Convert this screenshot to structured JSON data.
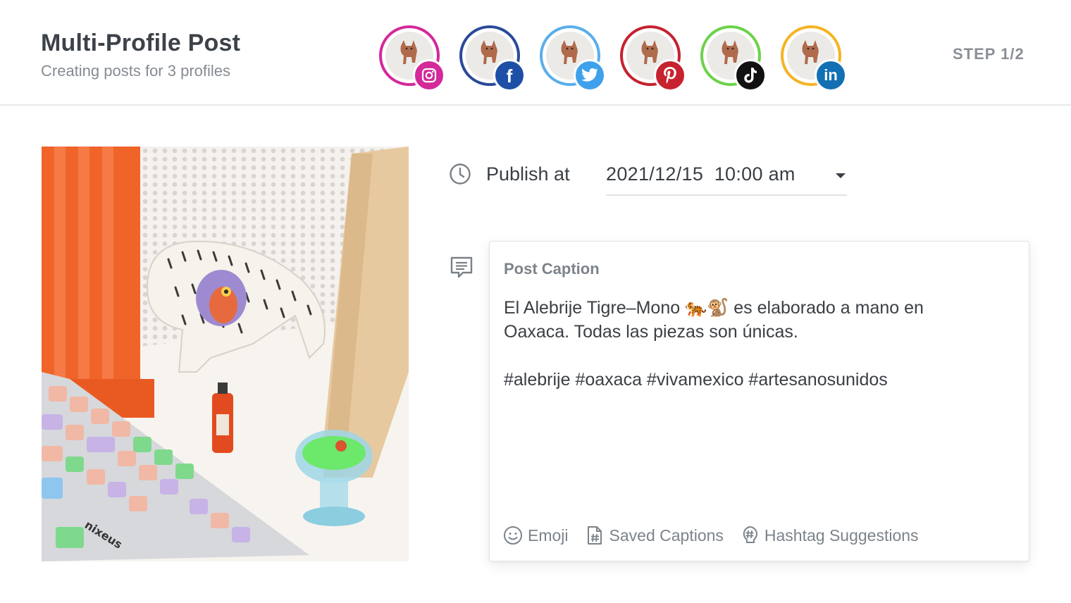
{
  "header": {
    "title": "Multi-Profile Post",
    "subtitle": "Creating posts for 3 profiles",
    "step": "STEP 1/2"
  },
  "profiles": [
    {
      "network": "instagram",
      "ring_color": "#d3299a",
      "badge_color": "#d3299a",
      "icon": "instagram-icon"
    },
    {
      "network": "facebook",
      "ring_color": "#2a4a9a",
      "badge_color": "#1d4fa6",
      "icon": "facebook-icon",
      "glyph": "f"
    },
    {
      "network": "twitter",
      "ring_color": "#5aaeea",
      "badge_color": "#3fa1ec",
      "icon": "twitter-icon"
    },
    {
      "network": "pinterest",
      "ring_color": "#c6222f",
      "badge_color": "#c6222f",
      "icon": "pinterest-icon"
    },
    {
      "network": "tiktok",
      "ring_color": "#6cd24a",
      "badge_color": "#111111",
      "icon": "tiktok-icon"
    },
    {
      "network": "linkedin",
      "ring_color": "#f5b323",
      "badge_color": "#1270b3",
      "icon": "linkedin-icon",
      "glyph": "in"
    }
  ],
  "publish": {
    "label": "Publish at",
    "value": "2021/12/15  10:00 am"
  },
  "caption": {
    "label": "Post Caption",
    "lines": [
      "El Alebrije Tigre–Mono 🐅🐒 es elaborado a mano en",
      "Oaxaca. Todas las piezas son únicas.",
      "",
      "#alebrije #oaxaca #vivamexico #artesanosunidos"
    ]
  },
  "toolbar": {
    "emoji": "Emoji",
    "saved": "Saved Captions",
    "hashtag": "Hashtag Suggestions"
  }
}
